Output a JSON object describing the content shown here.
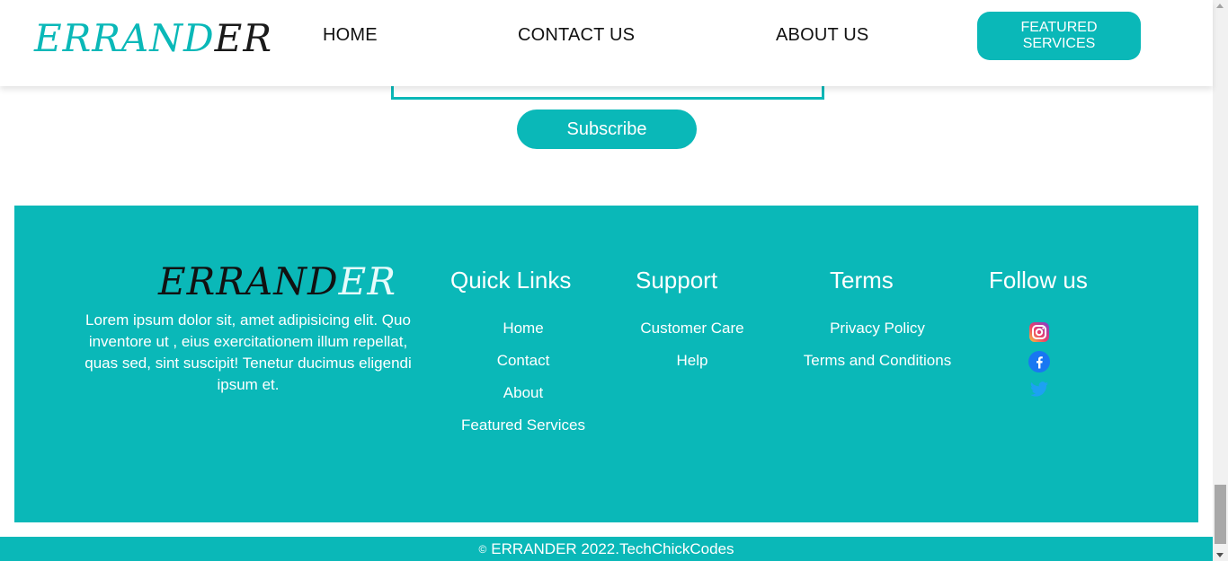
{
  "header": {
    "logo": {
      "part1": "ERRAND",
      "part2": "ER"
    },
    "nav": {
      "home": "HOME",
      "contact": "CONTACT US",
      "about": "ABOUT US"
    },
    "featured_button": "FEATURED SERVICES"
  },
  "newsletter": {
    "subscribe_label": "Subscribe"
  },
  "footer": {
    "logo": {
      "part1": "ERRAND",
      "part2": "ER"
    },
    "description": "Lorem ipsum dolor sit, amet adipisicing elit. Quo inventore ut , eius exercitationem illum repellat, quas sed, sint suscipit! Tenetur ducimus eligendi ipsum et.",
    "quick_links": {
      "title": "Quick Links",
      "items": [
        "Home",
        "Contact",
        "About",
        "Featured Services"
      ]
    },
    "support": {
      "title": "Support",
      "items": [
        "Customer Care",
        "Help"
      ]
    },
    "terms": {
      "title": "Terms",
      "items": [
        "Privacy Policy",
        "Terms and Conditions"
      ]
    },
    "follow": {
      "title": "Follow us",
      "icons": [
        "instagram-icon",
        "facebook-icon",
        "twitter-icon"
      ]
    }
  },
  "copyright": {
    "symbol": "©",
    "text": "ERRANDER 2022.TechChickCodes"
  },
  "colors": {
    "accent": "#0ab8b8",
    "text_dark": "#111111",
    "white": "#ffffff"
  }
}
